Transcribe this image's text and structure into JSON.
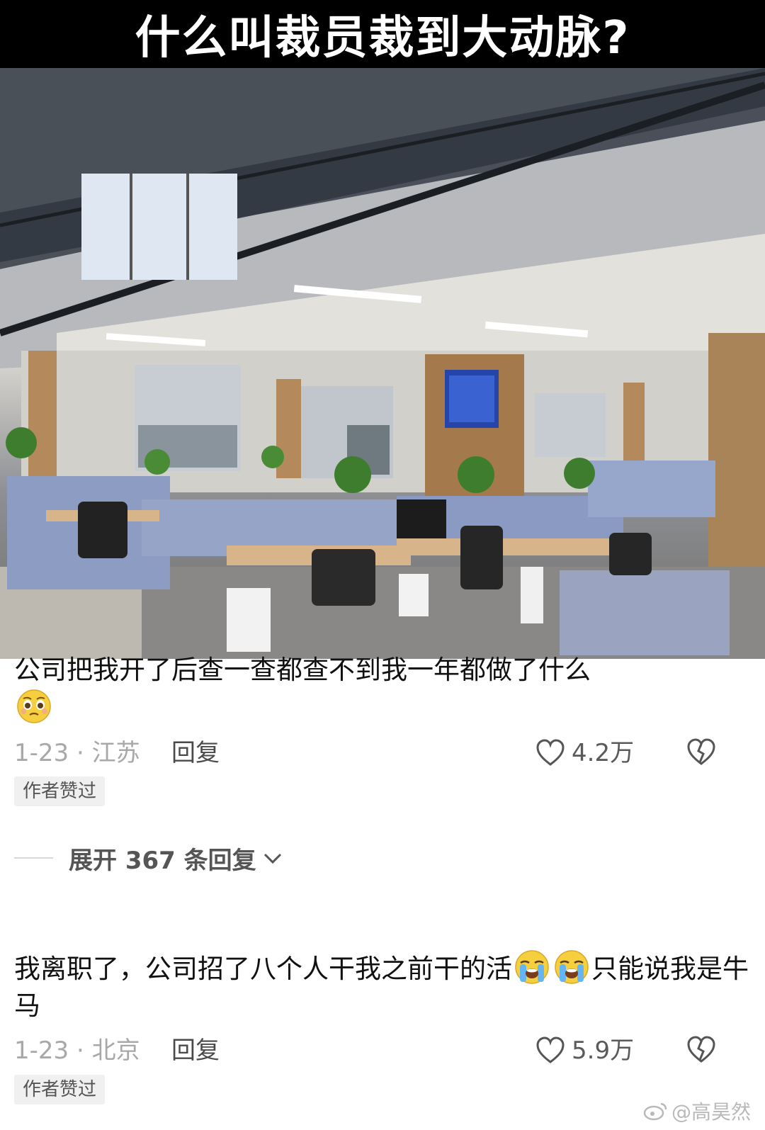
{
  "header": {
    "title": "什么叫裁员裁到大动脉?"
  },
  "comments": [
    {
      "text": "公司把我开了后查一查都查不到我一年都做了什么",
      "emojis": [
        "pleading-face-icon"
      ],
      "date_location": "1-23 · 江苏",
      "reply_label": "回复",
      "likes": "4.2万",
      "badge": "作者赞过"
    },
    {
      "text_before": "我离职了，公司招了八个人干我之前干的活",
      "emojis": [
        "loudly-crying-face-icon",
        "loudly-crying-face-icon"
      ],
      "text_after": "只能说我是牛马",
      "date_location": "1-23 · 北京",
      "reply_label": "回复",
      "likes": "5.9万",
      "badge": "作者赞过"
    }
  ],
  "expand_replies": {
    "label": "展开 367 条回复",
    "icon": "chevron-down-icon"
  },
  "watermark": {
    "text": "@高昊然",
    "icon": "weibo-logo-icon"
  },
  "colors": {
    "meta_gray": "#a8a8a8",
    "badge_bg": "#f0f0f0",
    "title_bg": "#000000"
  }
}
